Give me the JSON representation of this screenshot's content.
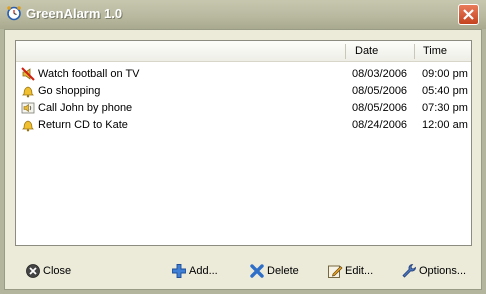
{
  "window": {
    "title": "GreenAlarm 1.0"
  },
  "list": {
    "columns": {
      "name": "",
      "date": "Date",
      "time": "Time"
    },
    "rows": [
      {
        "icon": "muted-speaker-icon",
        "text": "Watch football on TV",
        "date": "08/03/2006",
        "time": "09:00 pm"
      },
      {
        "icon": "bell-icon",
        "text": "Go shopping",
        "date": "08/05/2006",
        "time": "05:40 pm"
      },
      {
        "icon": "speaker-icon",
        "text": "Call John by phone",
        "date": "08/05/2006",
        "time": "07:30 pm"
      },
      {
        "icon": "bell-icon",
        "text": "Return CD to Kate",
        "date": "08/24/2006",
        "time": "12:00 am"
      }
    ]
  },
  "buttons": {
    "close": "Close",
    "add": "Add...",
    "delete": "Delete",
    "edit": "Edit...",
    "options": "Options..."
  }
}
